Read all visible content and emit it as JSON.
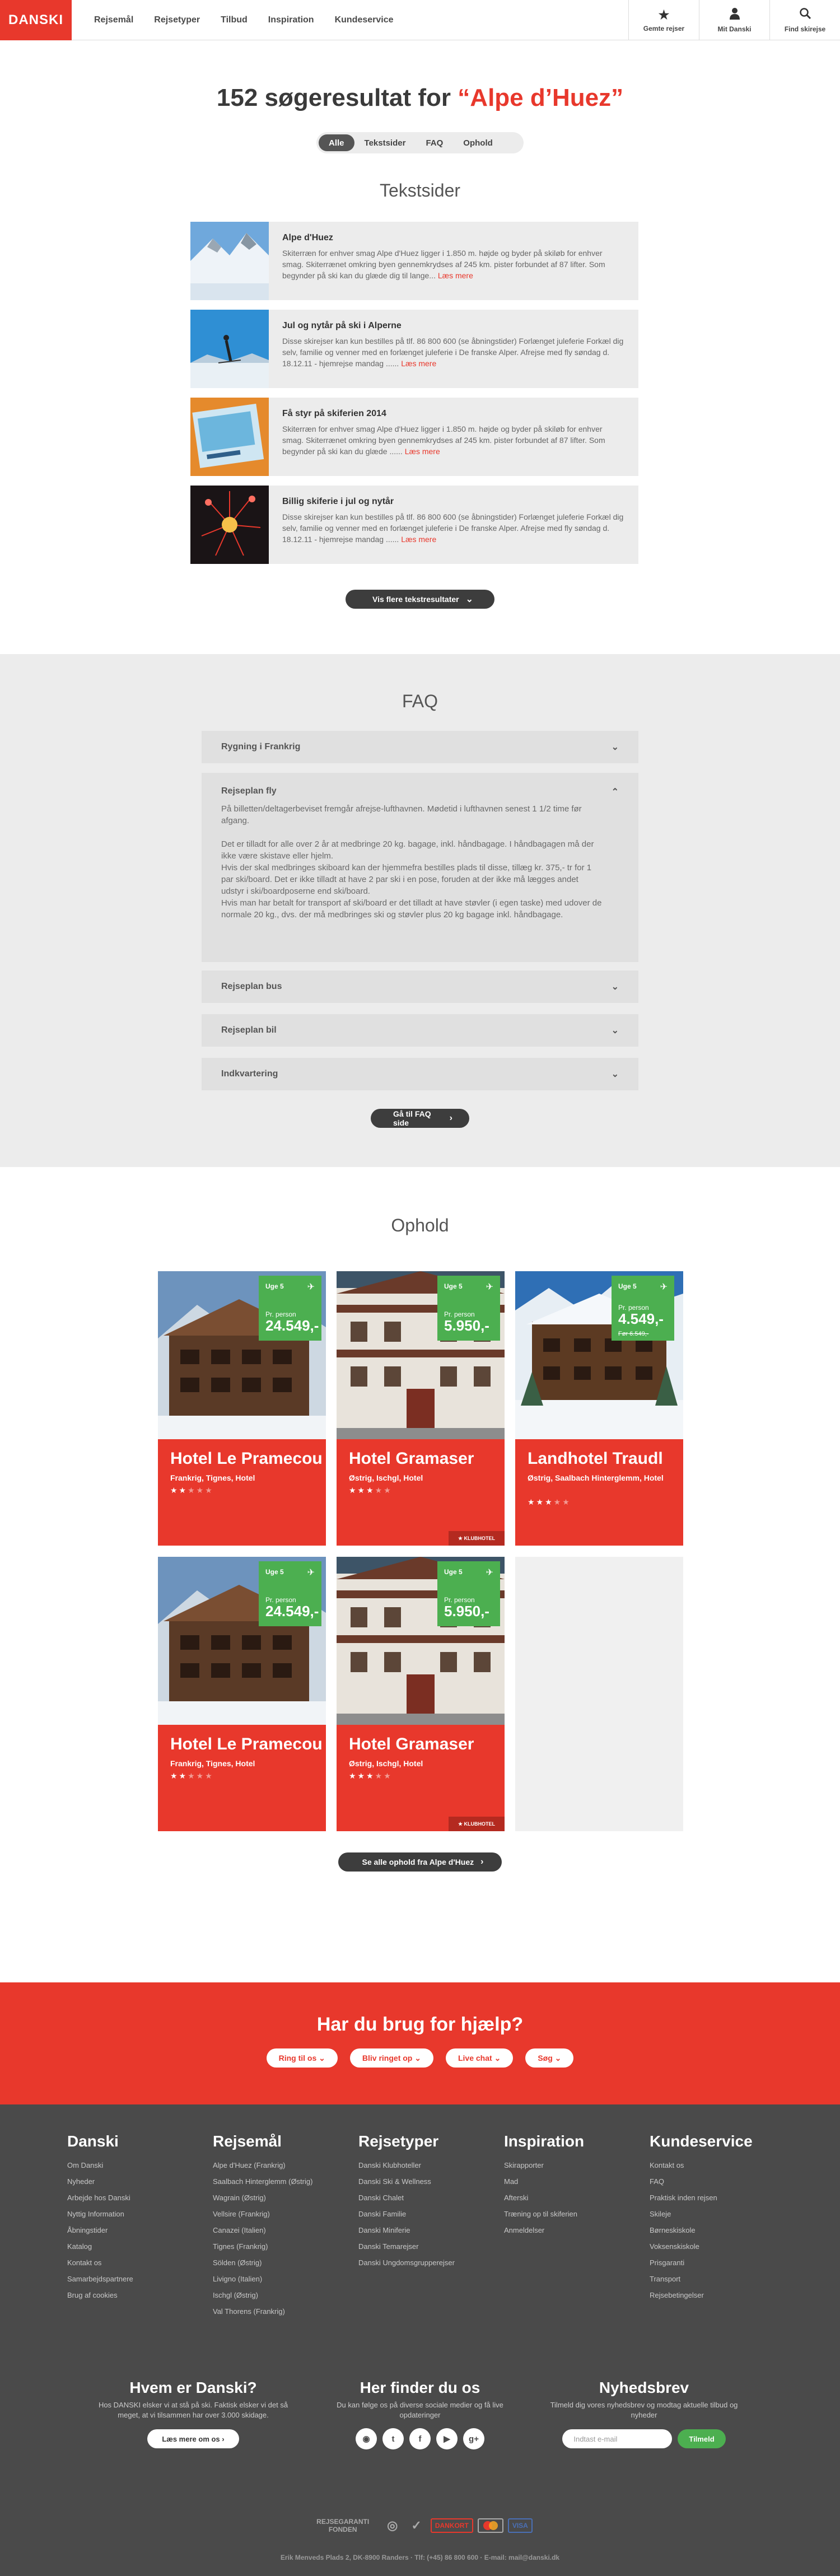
{
  "header": {
    "logo": "DANSKI",
    "nav": [
      "Rejsemål",
      "Rejsetyper",
      "Tilbud",
      "Inspiration",
      "Kundeservice"
    ],
    "buttons": [
      {
        "label": "Gemte rejser",
        "icon": "star-icon"
      },
      {
        "label": "Mit Danski",
        "icon": "user-icon"
      },
      {
        "label": "Find skirejse",
        "icon": "search-icon"
      }
    ]
  },
  "search": {
    "title_prefix": "152 søgeresultat for",
    "query": "“Alpe d’Huez”",
    "filters": [
      "Alle",
      "Tekstsider",
      "FAQ",
      "Ophold"
    ],
    "active_filter": "Alle"
  },
  "tekstsider": {
    "heading": "Tekstsider",
    "items": [
      {
        "title": "Alpe d'Huez",
        "text": "Skiterræn for enhver smag Alpe d'Huez ligger i 1.850 m. højde og byder på skiløb for enhver smag. Skiterrænet omkring byen gennemkrydses af 245 km. pister forbundet af 87 lifter. Som begynder på ski kan du glæde dig til lange...",
        "link": "Læs mere"
      },
      {
        "title": "Jul og nytår på ski i Alperne",
        "text": "Disse skirejser kan kun bestilles på tlf. 86 800 600 (se åbningstider)     Forlænget juleferie Forkæl dig selv, familie og venner med en forlænget juleferie i De franske Alper. Afrejse med fly søndag d. 18.12.11 - hjemrejse mandag ......",
        "link": "Læs mere"
      },
      {
        "title": "Få styr på skiferien 2014",
        "text": "Skiterræn for enhver smag Alpe d'Huez ligger i 1.850 m. højde og byder på skiløb for enhver smag. Skiterrænet omkring byen gennemkrydses af 245 km. pister forbundet af 87 lifter. Som begynder på ski kan du glæde ......",
        "link": "Læs mere"
      },
      {
        "title": "Billig skiferie i jul og nytår",
        "text": "Disse skirejser kan kun bestilles på tlf. 86 800 600 (se åbningstider)     Forlænget juleferie Forkæl dig selv, familie og venner med en forlænget juleferie i De franske Alper. Afrejse med fly søndag d. 18.12.11 - hjemrejse mandag ......",
        "link": "Læs mere"
      }
    ],
    "more_button": "Vis flere tekstresultater"
  },
  "faq": {
    "heading": "FAQ",
    "items": [
      "Rygning i Frankrig",
      "Rejseplan fly",
      "Rejseplan bus",
      "Rejseplan bil",
      "Indkvartering"
    ],
    "open": {
      "title": "Rejseplan fly",
      "paragraphs": [
        "På billetten/deltagerbeviset fremgår afrejse-lufthavnen. Mødetid i lufthavnen senest 1 1/2 time før afgang.",
        "Det er tilladt for alle over 2 år at medbringe 20 kg. bagage, inkl. håndbagage. I håndbagagen må der ikke være skistave eller hjelm.",
        "Hvis der skal medbringes skiboard kan der hjemmefra bestilles plads til disse, tillæg kr. 375,- tr for 1 par ski/board. Det er ikke tilladt at have 2 par ski i en pose, foruden at der ikke må lægges andet udstyr i ski/boardposerne end ski/board.",
        "Hvis man har betalt for transport af ski/board er det tilladt at have støvler (i egen taske) med udover de normale 20 kg., dvs. der må medbringes ski og støvler plus 20 kg bagage inkl. håndbagage."
      ]
    },
    "button": "Gå til FAQ side"
  },
  "ophold": {
    "heading": "Ophold",
    "cards": [
      {
        "name": "Hotel Le Pramecou",
        "location": "Frankrig, Tignes, Hotel",
        "uge": "Uge 5",
        "per": "Pr. person",
        "price": "24.549,-",
        "old_price": "",
        "stars": 2.5,
        "badge": ""
      },
      {
        "name": "Hotel Gramaser",
        "location": "Østrig, Ischgl, Hotel",
        "uge": "Uge 5",
        "per": "Pr. person",
        "price": "5.950,-",
        "old_price": "",
        "stars": 3,
        "badge": "KLUBHOTEL"
      },
      {
        "name": "Landhotel Traudl",
        "location": "Østrig, Saalbach Hinterglemm, Hotel",
        "uge": "Uge 5",
        "per": "Pr. person",
        "price": "4.549,-",
        "old_price": "Før 6.549,-",
        "stars": 3,
        "badge": ""
      },
      {
        "name": "Hotel Le Pramecou",
        "location": "Frankrig, Tignes, Hotel",
        "uge": "Uge 5",
        "per": "Pr. person",
        "price": "24.549,-",
        "old_price": "",
        "stars": 2.5,
        "badge": ""
      },
      {
        "name": "Hotel Gramaser",
        "location": "Østrig, Ischgl, Hotel",
        "uge": "Uge 5",
        "per": "Pr. person",
        "price": "5.950,-",
        "old_price": "",
        "stars": 3,
        "badge": "KLUBHOTEL"
      }
    ],
    "button": "Se alle ophold fra Alpe d'Huez"
  },
  "help": {
    "title": "Har du brug for hjælp?",
    "buttons": [
      "Ring til os",
      "Bliv ringet op",
      "Live chat",
      "Søg"
    ]
  },
  "footer": {
    "columns": [
      {
        "title": "Danski",
        "links": [
          "Om Danski",
          "Nyheder",
          "Arbejde hos Danski",
          "Nyttig Information",
          "Åbningstider",
          "Katalog",
          "Kontakt os",
          "Samarbejdspartnere",
          "Brug af cookies"
        ]
      },
      {
        "title": "Rejsemål",
        "links": [
          "Alpe d'Huez (Frankrig)",
          "Saalbach Hinterglemm (Østrig)",
          "Wagrain (Østrig)",
          "Vellsire (Frankrig)",
          "Canazei (Italien)",
          "Tignes (Frankrig)",
          "Sölden (Østrig)",
          "Livigno (Italien)",
          "Ischgl (Østrig)",
          "Val Thorens (Frankrig)"
        ]
      },
      {
        "title": "Rejsetyper",
        "links": [
          "Danski Klubhoteller",
          "Danski Ski & Wellness",
          "Danski Chalet",
          "Danski Familie",
          "Danski Miniferie",
          "Danski Temarejser",
          "Danski Ungdomsgrupperejser"
        ]
      },
      {
        "title": "Inspiration",
        "links": [
          "Skirapporter",
          "Mad",
          "Afterski",
          "Træning op til skiferien",
          "Anmeldelser"
        ]
      },
      {
        "title": "Kundeservice",
        "links": [
          "Kontakt os",
          "FAQ",
          "Praktisk inden rejsen",
          "Skileje",
          "Børneskiskole",
          "Voksenskiskole",
          "Prisgaranti",
          "Transport",
          "Rejsebetingelser"
        ]
      }
    ],
    "about": {
      "title": "Hvem er Danski?",
      "text": "Hos DANSKI elsker vi at stå på ski. Faktisk elsker vi det så meget, at vi tilsammen har over 3.000 skidage.",
      "button": "Læs mere om os"
    },
    "social": {
      "title": "Her finder du os",
      "text": "Du kan følge os på diverse sociale medier og få live opdateringer",
      "icons": [
        "rss-icon",
        "twitter-icon",
        "facebook-icon",
        "youtube-icon",
        "googleplus-icon"
      ]
    },
    "newsletter": {
      "title": "Nyhedsbrev",
      "text": "Tilmeld dig vores nyhedsbrev og modtag aktuelle tilbud og nyheder",
      "placeholder": "Indtast e-mail",
      "button": "Tilmeld"
    },
    "certs": [
      "REJSEGARANTI FONDEN",
      "DANKORT",
      "VISA"
    ],
    "address": "Erik Menveds Plads 2, DK-8900 Randers · Tlf: (+45) 86 800 600 · E-mail: mail@danski.dk"
  },
  "colors": {
    "brand": "#e8382c",
    "price_box": "#4caf50",
    "dark": "#3d3d3d"
  }
}
